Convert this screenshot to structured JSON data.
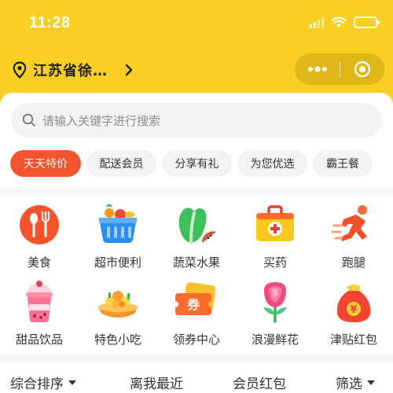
{
  "status_bar": {
    "time": "11:28"
  },
  "header": {
    "location": "江苏省徐…"
  },
  "search": {
    "placeholder": "请输入关键字进行搜索"
  },
  "tags": [
    {
      "label": "天天特价",
      "active": true
    },
    {
      "label": "配送会员"
    },
    {
      "label": "分享有礼"
    },
    {
      "label": "为您优选"
    },
    {
      "label": "霸王餐"
    }
  ],
  "categories": [
    {
      "label": "美食",
      "icon": "food-icon"
    },
    {
      "label": "超市便利",
      "icon": "supermarket-basket-icon"
    },
    {
      "label": "蔬菜水果",
      "icon": "vegetable-fruit-icon"
    },
    {
      "label": "买药",
      "icon": "medicine-kit-icon"
    },
    {
      "label": "跑腿",
      "icon": "errand-runner-icon"
    },
    {
      "label": "甜品饮品",
      "icon": "dessert-drink-icon"
    },
    {
      "label": "特色小吃",
      "icon": "snack-platter-icon"
    },
    {
      "label": "领券中心",
      "icon": "coupon-icon"
    },
    {
      "label": "浪漫鲜花",
      "icon": "flower-icon"
    },
    {
      "label": "津贴红包",
      "icon": "red-envelope-icon"
    }
  ],
  "sort_bar": {
    "comprehensive": "综合排序",
    "nearest": "离我最近",
    "member_coupon": "会员红包",
    "filter": "筛选"
  },
  "colors": {
    "brand_yellow": "#f9cf23",
    "active_tag": "#f2542d"
  }
}
